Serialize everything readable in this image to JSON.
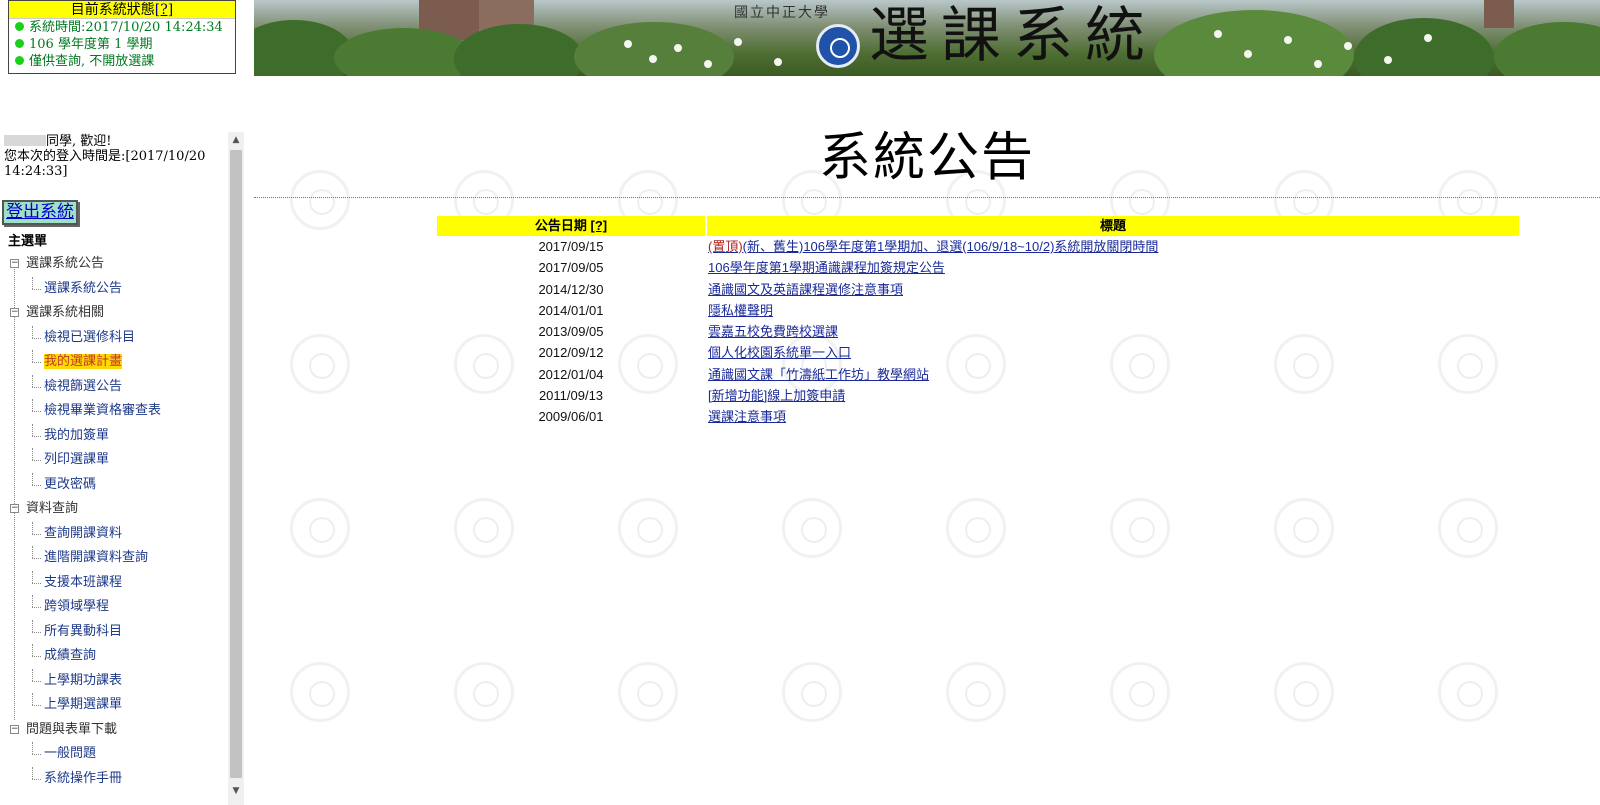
{
  "status": {
    "title": "目前系統狀態",
    "help": "[?]",
    "lines": [
      "系統時間:2017/10/20 14:24:34",
      "106 學年度第 1 學期",
      "僅供查詢, 不開放選課"
    ]
  },
  "banner": {
    "university": "國立中正大學",
    "title": "選課系統"
  },
  "sidebar": {
    "welcome": "同學, 歡迎!",
    "login_time": "您本次的登入時間是:[2017/10/20 14:24:33]",
    "logout": "登出系統",
    "menu_head": "主選單",
    "groups": [
      {
        "label": "選課系統公告",
        "items": [
          "選課系統公告"
        ]
      },
      {
        "label": "選課系統相關",
        "items": [
          "檢視已選修科目",
          "我的選課計畫",
          "檢視篩選公告",
          "檢視畢業資格審查表",
          "我的加簽單",
          "列印選課單",
          "更改密碼"
        ]
      },
      {
        "label": "資料查詢",
        "items": [
          "查詢開課資料",
          "進階開課資料查詢",
          "支援本班課程",
          "跨領域學程",
          "所有異動科目",
          "成績查詢",
          "上學期功課表",
          "上學期選課單"
        ]
      },
      {
        "label": "問題與表單下載",
        "items": [
          "一般問題",
          "系統操作手冊"
        ]
      }
    ],
    "highlighted_item": "我的選課計畫"
  },
  "main": {
    "page_title": "系統公告",
    "table": {
      "col_date": "公告日期",
      "col_date_help": "[?]",
      "col_title": "標題",
      "rows": [
        {
          "date": "2017/09/15",
          "pin": "(置頂)",
          "title": "(新、舊生)106學年度第1學期加、退選(106/9/18~10/2)系統開放關閉時間"
        },
        {
          "date": "2017/09/05",
          "pin": "",
          "title": "106學年度第1學期通識課程加簽規定公告"
        },
        {
          "date": "2014/12/30",
          "pin": "",
          "title": "通識國文及英語課程選修注意事項"
        },
        {
          "date": "2014/01/01",
          "pin": "",
          "title": "隱私權聲明"
        },
        {
          "date": "2013/09/05",
          "pin": "",
          "title": "雲嘉五校免費跨校選課"
        },
        {
          "date": "2012/09/12",
          "pin": "",
          "title": "個人化校園系統單一入口"
        },
        {
          "date": "2012/01/04",
          "pin": "",
          "title": "通識國文課「竹濤紙工作坊」教學網站"
        },
        {
          "date": "2011/09/13",
          "pin": "",
          "title": "[新增功能]線上加簽申請"
        },
        {
          "date": "2009/06/01",
          "pin": "",
          "title": "選課注意事項"
        }
      ]
    }
  },
  "colors": {
    "header_yellow": "#ffff00",
    "link_blue": "#1a2a99",
    "pin_red": "#b02020",
    "status_green": "#007a1f"
  }
}
